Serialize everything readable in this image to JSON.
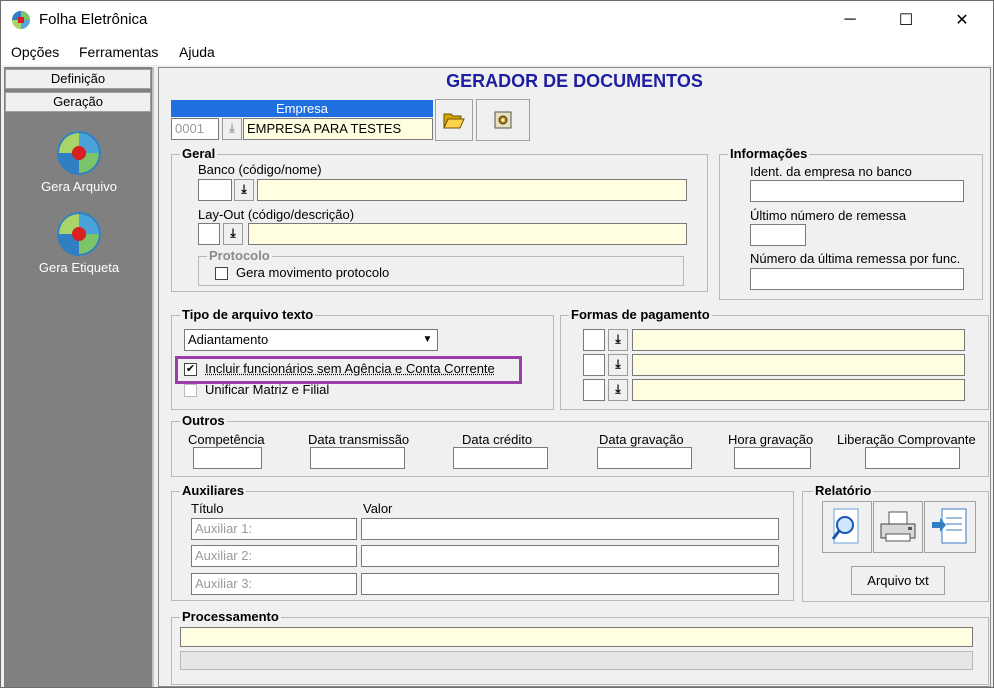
{
  "window": {
    "title": "Folha Eletrônica",
    "minimize": "─",
    "maximize": "☐",
    "close": "✕"
  },
  "menu": [
    "Opções",
    "Ferramentas",
    "Ajuda"
  ],
  "left": {
    "tabs": [
      "Definição",
      "Geração"
    ],
    "tools": [
      "Gera Arquivo",
      "Gera Etiqueta"
    ]
  },
  "main": {
    "title": "GERADOR DE DOCUMENTOS",
    "empresa": {
      "header": "Empresa",
      "code": "0001",
      "name": "EMPRESA PARA TESTES"
    },
    "geral": {
      "title": "Geral",
      "banco_label": "Banco (código/nome)",
      "layout_label": "Lay-Out (código/descrição)",
      "protocolo_title": "Protocolo",
      "protocolo_check": "Gera movimento protocolo"
    },
    "info": {
      "title": "Informações",
      "ident_label": "Ident. da empresa no banco",
      "ultimo_label": "Último número de remessa",
      "numero_label": "Número da última remessa por func."
    },
    "tipo": {
      "title": "Tipo de arquivo texto",
      "selected": "Adiantamento",
      "check1": "Incluir funcionários sem Agência e Conta Corrente",
      "check2": "Unificar Matriz e Filial"
    },
    "formas": {
      "title": "Formas de pagamento"
    },
    "outros": {
      "title": "Outros",
      "labels": [
        "Competência",
        "Data transmissão",
        "Data crédito",
        "Data gravação",
        "Hora gravação",
        "Liberação Comprovante"
      ]
    },
    "auxiliares": {
      "title": "Auxiliares",
      "col_titulo": "Título",
      "col_valor": "Valor",
      "rows": [
        "Auxiliar 1:",
        "Auxiliar 2:",
        "Auxiliar 3:"
      ]
    },
    "relatorio": {
      "title": "Relatório",
      "button": "Arquivo txt"
    },
    "processamento": {
      "title": "Processamento"
    }
  },
  "colors": {
    "title": "#1e1ea0",
    "highlight": "#9b3fa8",
    "yellow": "#fffee0",
    "panel": "#808080"
  }
}
